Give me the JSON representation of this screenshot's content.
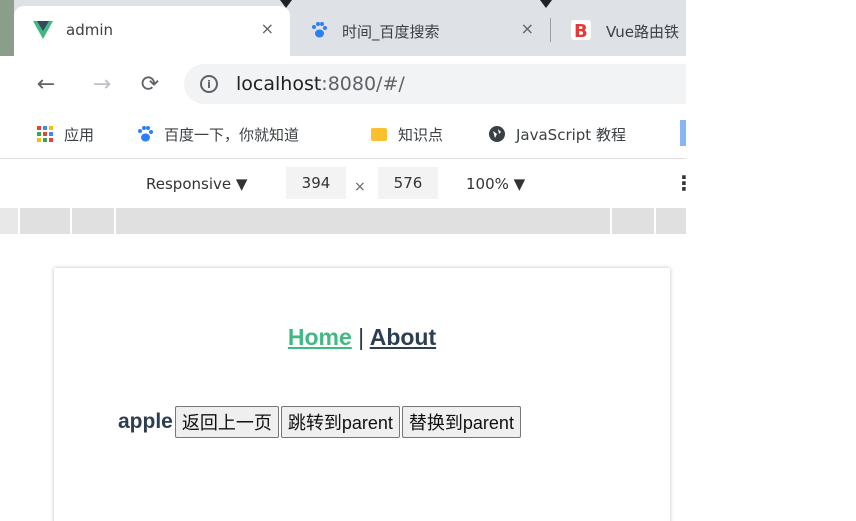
{
  "tabs": [
    {
      "title": "admin",
      "favicon": "vue-icon",
      "active": true,
      "close": "×"
    },
    {
      "title": "时间_百度搜索",
      "favicon": "baidu-paw-icon",
      "active": false,
      "close": "×"
    },
    {
      "title": "Vue路由铁",
      "favicon": "b-logo-icon",
      "active": false
    }
  ],
  "address_bar": {
    "host": "localhost",
    "rest": ":8080/#/"
  },
  "bookmarks": [
    {
      "label": "应用",
      "icon": "apps-grid-icon"
    },
    {
      "label": "百度一下，你就知道",
      "icon": "baidu-paw-icon"
    },
    {
      "label": "知识点",
      "icon": "folder-icon"
    },
    {
      "label": "JavaScript 教程",
      "icon": "globe-icon"
    }
  ],
  "devtools": {
    "mode": "Responsive ▼",
    "width": "394",
    "times": "×",
    "height": "576",
    "zoom": "100% ▼",
    "more": "⋮"
  },
  "app": {
    "nav_home": "Home",
    "nav_sep": "|",
    "nav_about": "About",
    "item": "apple",
    "btn_back": "返回上一页",
    "btn_jump": "跳转到parent",
    "btn_replace": "替换到parent"
  },
  "colors": {
    "vue_green": "#42b983",
    "text_dark": "#2c3e50",
    "tabstrip": "#dee1e6"
  }
}
